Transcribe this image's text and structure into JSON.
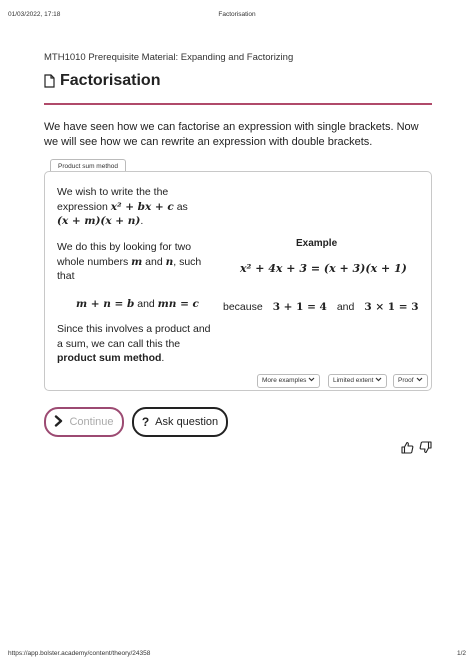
{
  "print_header": {
    "datetime": "01/03/2022, 17:18",
    "doc_title": "Factorisation"
  },
  "course": "MTH1010 Prerequisite Material: Expanding and Factorizing",
  "page_title": "Factorisation",
  "intro": "We have seen how we can factorise an expression with single brackets. Now we will see how we can rewrite an expression with double brackets.",
  "tab_label": "Product sum method",
  "card": {
    "p1_line1": "We wish to write the the",
    "p1_line2_pre": "expression ",
    "p1_math1": "x² + bx + c",
    "p1_line2_post": " as",
    "p1_math2": "(x + m)(x + n)",
    "p1_end": ".",
    "p2_line1": "We do this by looking for two",
    "p2_line2_pre": "whole numbers ",
    "p2_m": "m",
    "p2_and": " and ",
    "p2_n": "n",
    "p2_line2_post": ", such",
    "p2_line3": "that",
    "eq_sum": "m + n = b",
    "eq_and": " and ",
    "eq_prod": "mn = c",
    "p3_line1": "Since this involves a product and",
    "p3_line2": "a sum, we can call this the",
    "p3_bold": "product sum method",
    "p3_end": ".",
    "example_heading": "Example",
    "example_eq": "x² + 4x + 3 = (x + 3)(x + 1)",
    "because": "because",
    "example_sum": "3 + 1 = 4",
    "example_and": "and",
    "example_prod": "3 × 1 = 3"
  },
  "dropdowns": [
    "More examples",
    "Limited extent",
    "Proof"
  ],
  "buttons": {
    "continue": "Continue",
    "ask": "Ask question"
  },
  "icons": {
    "thumbs_up": "thumbs-up-icon",
    "thumbs_down": "thumbs-down-icon"
  },
  "print_footer": {
    "url": "https://app.bolster.academy/content/theory/24358",
    "page": "1/2"
  },
  "colors": {
    "accent": "#9c4a72",
    "rule": "#b04a6a"
  }
}
